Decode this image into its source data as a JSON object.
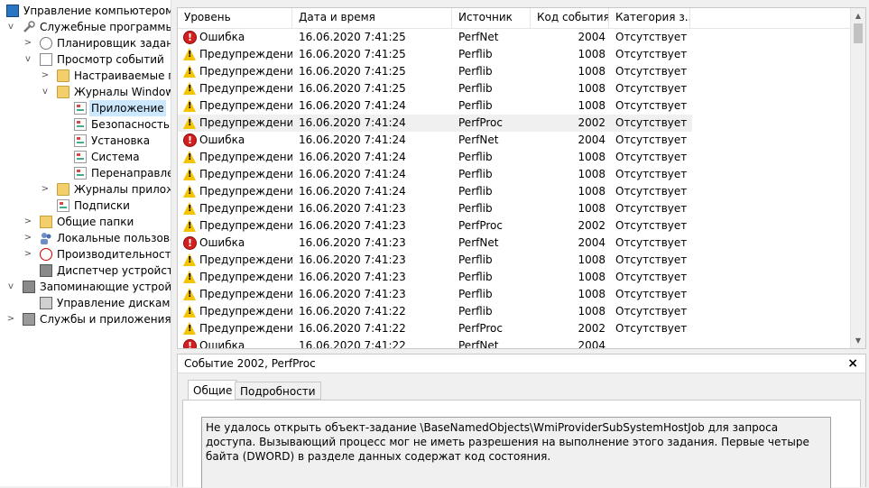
{
  "tree": {
    "items": [
      {
        "label": "Управление компьютером (л",
        "expander": "",
        "level": 0,
        "icon": "computer-management-icon"
      },
      {
        "label": "Служебные программы",
        "expander": "v",
        "level": 0,
        "icon": "tools-icon"
      },
      {
        "label": "Планировщик заданий",
        "expander": ">",
        "level": 1,
        "icon": "clock-icon"
      },
      {
        "label": "Просмотр событий",
        "expander": "v",
        "level": 1,
        "icon": "event-viewer-icon"
      },
      {
        "label": "Настраиваемые пр",
        "expander": ">",
        "level": 2,
        "icon": "folder-icon"
      },
      {
        "label": "Журналы Windows",
        "expander": "v",
        "level": 2,
        "icon": "folder-icon"
      },
      {
        "label": "Приложение",
        "expander": "",
        "level": 3,
        "icon": "log-icon",
        "selected": true
      },
      {
        "label": "Безопасность",
        "expander": "",
        "level": 3,
        "icon": "log-icon"
      },
      {
        "label": "Установка",
        "expander": "",
        "level": 3,
        "icon": "log-icon"
      },
      {
        "label": "Система",
        "expander": "",
        "level": 3,
        "icon": "log-icon"
      },
      {
        "label": "Перенаправлен",
        "expander": "",
        "level": 3,
        "icon": "log-icon"
      },
      {
        "label": "Журналы приложе",
        "expander": ">",
        "level": 2,
        "icon": "folder-icon"
      },
      {
        "label": "Подписки",
        "expander": "",
        "level": 2,
        "icon": "log-icon"
      },
      {
        "label": "Общие папки",
        "expander": ">",
        "level": 1,
        "icon": "shared-folder-icon"
      },
      {
        "label": "Локальные пользовате",
        "expander": ">",
        "level": 1,
        "icon": "users-icon"
      },
      {
        "label": "Производительность",
        "expander": ">",
        "level": 1,
        "icon": "performance-icon"
      },
      {
        "label": "Диспетчер устройств",
        "expander": "",
        "level": 1,
        "icon": "device-manager-icon"
      },
      {
        "label": "Запоминающие устройст",
        "expander": "v",
        "level": 0,
        "icon": "storage-icon"
      },
      {
        "label": "Управление дисками",
        "expander": "",
        "level": 1,
        "icon": "disk-icon"
      },
      {
        "label": "Службы и приложения",
        "expander": ">",
        "level": 0,
        "icon": "services-icon"
      }
    ]
  },
  "events": {
    "columns": [
      "Уровень",
      "Дата и время",
      "Источник",
      "Код события",
      "Категория з..."
    ],
    "rows": [
      {
        "level": "Ошибка",
        "type": "error",
        "datetime": "16.06.2020 7:41:25",
        "source": "PerfNet",
        "id": "2004",
        "category": "Отсутствует"
      },
      {
        "level": "Предупреждение",
        "type": "warning",
        "datetime": "16.06.2020 7:41:25",
        "source": "Perflib",
        "id": "1008",
        "category": "Отсутствует"
      },
      {
        "level": "Предупреждение",
        "type": "warning",
        "datetime": "16.06.2020 7:41:25",
        "source": "Perflib",
        "id": "1008",
        "category": "Отсутствует"
      },
      {
        "level": "Предупреждение",
        "type": "warning",
        "datetime": "16.06.2020 7:41:25",
        "source": "Perflib",
        "id": "1008",
        "category": "Отсутствует"
      },
      {
        "level": "Предупреждение",
        "type": "warning",
        "datetime": "16.06.2020 7:41:24",
        "source": "Perflib",
        "id": "1008",
        "category": "Отсутствует"
      },
      {
        "level": "Предупреждение",
        "type": "warning",
        "datetime": "16.06.2020 7:41:24",
        "source": "PerfProc",
        "id": "2002",
        "category": "Отсутствует",
        "highlighted": true
      },
      {
        "level": "Ошибка",
        "type": "error",
        "datetime": "16.06.2020 7:41:24",
        "source": "PerfNet",
        "id": "2004",
        "category": "Отсутствует"
      },
      {
        "level": "Предупреждение",
        "type": "warning",
        "datetime": "16.06.2020 7:41:24",
        "source": "Perflib",
        "id": "1008",
        "category": "Отсутствует"
      },
      {
        "level": "Предупреждение",
        "type": "warning",
        "datetime": "16.06.2020 7:41:24",
        "source": "Perflib",
        "id": "1008",
        "category": "Отсутствует"
      },
      {
        "level": "Предупреждение",
        "type": "warning",
        "datetime": "16.06.2020 7:41:24",
        "source": "Perflib",
        "id": "1008",
        "category": "Отсутствует"
      },
      {
        "level": "Предупреждение",
        "type": "warning",
        "datetime": "16.06.2020 7:41:23",
        "source": "Perflib",
        "id": "1008",
        "category": "Отсутствует"
      },
      {
        "level": "Предупреждение",
        "type": "warning",
        "datetime": "16.06.2020 7:41:23",
        "source": "PerfProc",
        "id": "2002",
        "category": "Отсутствует"
      },
      {
        "level": "Ошибка",
        "type": "error",
        "datetime": "16.06.2020 7:41:23",
        "source": "PerfNet",
        "id": "2004",
        "category": "Отсутствует"
      },
      {
        "level": "Предупреждение",
        "type": "warning",
        "datetime": "16.06.2020 7:41:23",
        "source": "Perflib",
        "id": "1008",
        "category": "Отсутствует"
      },
      {
        "level": "Предупреждение",
        "type": "warning",
        "datetime": "16.06.2020 7:41:23",
        "source": "Perflib",
        "id": "1008",
        "category": "Отсутствует"
      },
      {
        "level": "Предупреждение",
        "type": "warning",
        "datetime": "16.06.2020 7:41:23",
        "source": "Perflib",
        "id": "1008",
        "category": "Отсутствует"
      },
      {
        "level": "Предупреждение",
        "type": "warning",
        "datetime": "16.06.2020 7:41:22",
        "source": "Perflib",
        "id": "1008",
        "category": "Отсутствует"
      },
      {
        "level": "Предупреждение",
        "type": "warning",
        "datetime": "16.06.2020 7:41:22",
        "source": "PerfProc",
        "id": "2002",
        "category": "Отсутствует"
      },
      {
        "level": "Ошибка",
        "type": "error",
        "datetime": "16.06.2020 7:41:22",
        "source": "PerfNet",
        "id": "2004",
        "category": ""
      }
    ]
  },
  "detail": {
    "title": "Событие 2002, PerfProc",
    "close": "×",
    "tabs": [
      "Общие",
      "Подробности"
    ],
    "message": "Не удалось открыть объект-задание \\BaseNamedObjects\\WmiProviderSubSystemHostJob для запроса доступа. Вызывающий процесс мог не иметь разрешения на выполнение этого задания. Первые четыре байта (DWORD) в разделе данных содержат код состояния."
  },
  "colors": {
    "selection": "#cce8ff",
    "row_highlight": "#f0f0f0",
    "error": "#d21f1f",
    "warning": "#f5c400"
  }
}
